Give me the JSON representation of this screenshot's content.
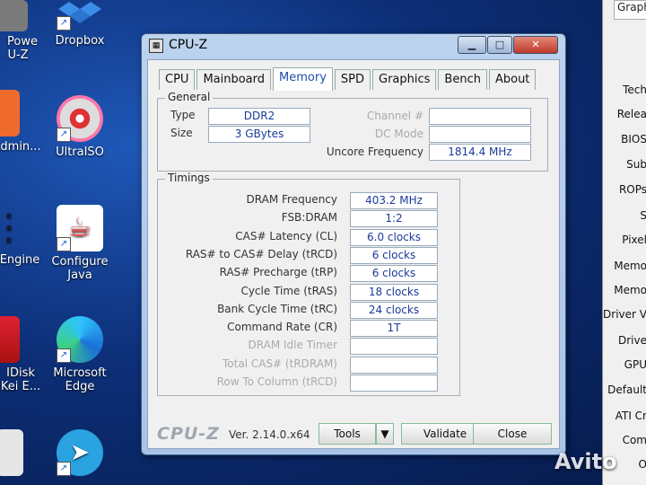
{
  "desktop": {
    "icons": [
      {
        "label_lines": [
          "Powe",
          "U-Z"
        ]
      },
      {
        "label_lines": [
          "Dropbox"
        ]
      },
      {
        "label_lines": [
          "dmin..."
        ]
      },
      {
        "label_lines": [
          "UltraISO"
        ]
      },
      {
        "label_lines": [
          "Engine"
        ]
      },
      {
        "label_lines": [
          "Configure",
          "Java"
        ]
      },
      {
        "label_lines": [
          "IDisk",
          "Kei E..."
        ]
      },
      {
        "label_lines": [
          "Microsoft",
          "Edge"
        ]
      }
    ]
  },
  "side_window": {
    "title": "Graph",
    "labels": [
      "Tech",
      "Relea",
      "BIOS",
      "Sub",
      "ROPs",
      "S",
      "Pixel",
      "Memo",
      "Memo",
      "Driver V",
      "Drive",
      "GPU",
      "Default",
      "ATI Cr",
      "Com",
      "O"
    ]
  },
  "cpuz": {
    "title": "CPU-Z",
    "tabs": [
      "CPU",
      "Mainboard",
      "Memory",
      "SPD",
      "Graphics",
      "Bench",
      "About"
    ],
    "active_tab": "Memory",
    "general": {
      "title": "General",
      "type_label": "Type",
      "type_value": "DDR2",
      "size_label": "Size",
      "size_value": "3 GBytes",
      "channel_label": "Channel #",
      "channel_value": "",
      "dcmode_label": "DC Mode",
      "dcmode_value": "",
      "uncore_label": "Uncore Frequency",
      "uncore_value": "1814.4 MHz"
    },
    "timings": {
      "title": "Timings",
      "rows": [
        {
          "label": "DRAM Frequency",
          "value": "403.2 MHz",
          "dim": false
        },
        {
          "label": "FSB:DRAM",
          "value": "1:2",
          "dim": false
        },
        {
          "label": "CAS# Latency (CL)",
          "value": "6.0 clocks",
          "dim": false
        },
        {
          "label": "RAS# to CAS# Delay (tRCD)",
          "value": "6 clocks",
          "dim": false
        },
        {
          "label": "RAS# Precharge (tRP)",
          "value": "6 clocks",
          "dim": false
        },
        {
          "label": "Cycle Time (tRAS)",
          "value": "18 clocks",
          "dim": false
        },
        {
          "label": "Bank Cycle Time (tRC)",
          "value": "24 clocks",
          "dim": false
        },
        {
          "label": "Command Rate (CR)",
          "value": "1T",
          "dim": false
        },
        {
          "label": "DRAM Idle Timer",
          "value": "",
          "dim": true
        },
        {
          "label": "Total CAS# (tRDRAM)",
          "value": "",
          "dim": true
        },
        {
          "label": "Row To Column (tRCD)",
          "value": "",
          "dim": true
        }
      ]
    },
    "footer": {
      "brand": "CPU-Z",
      "version": "Ver. 2.14.0.x64",
      "tools": "Tools",
      "validate": "Validate",
      "close": "Close"
    }
  },
  "watermark": "Avito"
}
